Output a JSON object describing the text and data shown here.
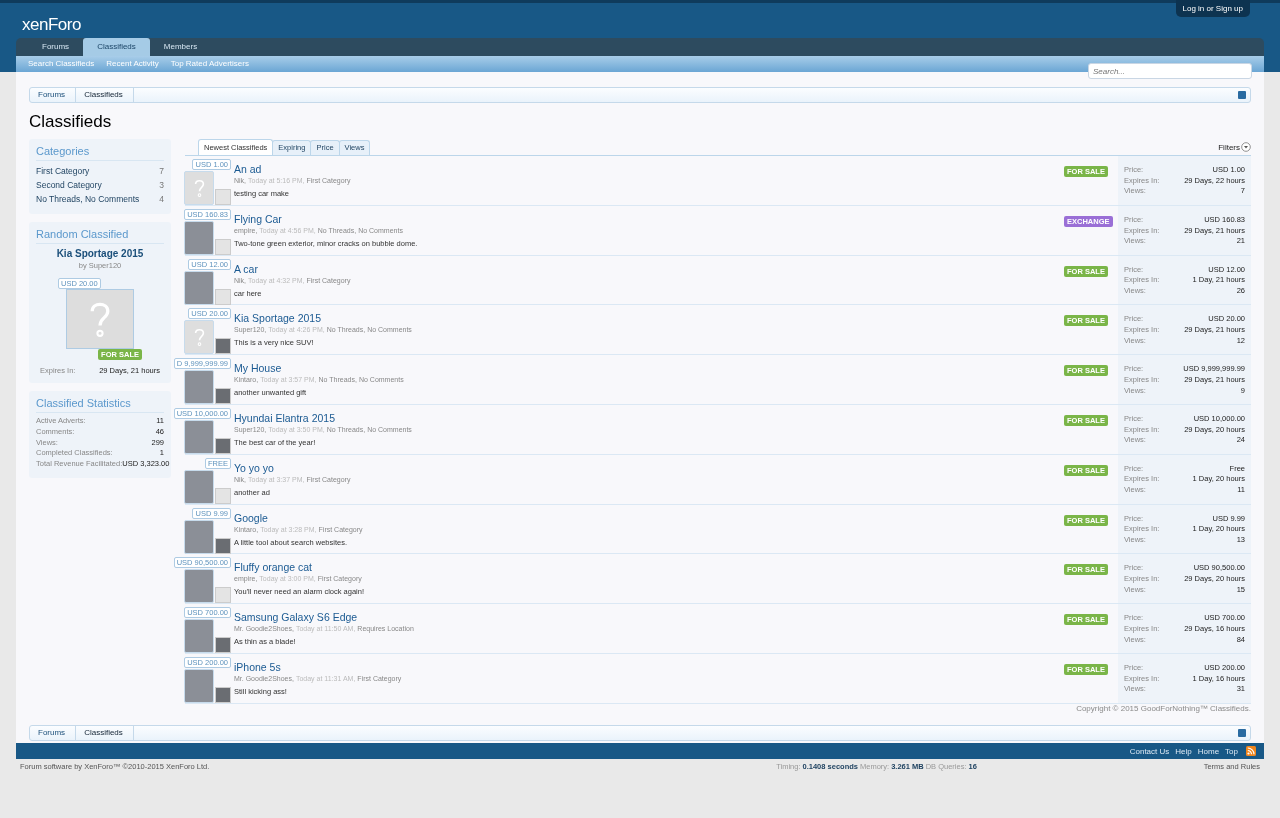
{
  "header": {
    "logo": "xenForo",
    "login": "Log in or Sign up"
  },
  "nav": {
    "tabs": [
      {
        "label": "Forums",
        "selected": false
      },
      {
        "label": "Classifieds",
        "selected": true
      },
      {
        "label": "Members",
        "selected": false
      }
    ],
    "sublinks": [
      "Search Classifieds",
      "Recent Activity",
      "Top Rated Advertisers"
    ],
    "search": {
      "placeholder": "Search..."
    }
  },
  "breadcrumb": [
    "Forums",
    "Classifieds"
  ],
  "title": "Classifieds",
  "sidebar": {
    "categories": {
      "heading": "Categories",
      "items": [
        {
          "label": "First Category",
          "count": "7"
        },
        {
          "label": "Second Category",
          "count": "3"
        },
        {
          "label": "No Threads, No Comments",
          "count": "4"
        }
      ]
    },
    "random": {
      "heading": "Random Classified",
      "title": "Kia Sportage 2015",
      "by": "by Super120",
      "price": "USD 20.00",
      "badge": "FOR SALE",
      "expires_label": "Expires In:",
      "expires": "29 Days, 21 hours"
    },
    "stats": {
      "heading": "Classified Statistics",
      "rows": [
        {
          "label": "Active Adverts:",
          "value": "11"
        },
        {
          "label": "Comments:",
          "value": "46"
        },
        {
          "label": "Views:",
          "value": "299"
        },
        {
          "label": "Completed Classifieds:",
          "value": "1"
        },
        {
          "label": "Total Revenue Facilitated:",
          "value": "USD 3,323.00"
        }
      ]
    }
  },
  "list": {
    "tabs": [
      {
        "label": "Newest Classifieds",
        "selected": true
      },
      {
        "label": "Expiring",
        "selected": false
      },
      {
        "label": "Price",
        "selected": false
      },
      {
        "label": "Views",
        "selected": false
      }
    ],
    "filters": "Filters",
    "rows": [
      {
        "title": "An ad",
        "tag": "USD 1.00",
        "has_photo": false,
        "avatar_photo": false,
        "meta": [
          {
            "kind": "author",
            "text": "Nik,"
          },
          {
            "kind": "date",
            "text": "Today at 5:16 PM,"
          },
          {
            "kind": "link",
            "text": "First Category"
          }
        ],
        "desc": "testing car make",
        "badge": {
          "text": "FOR SALE",
          "color": "#7ab548"
        },
        "price_label": "Price:",
        "price": "USD 1.00",
        "expires_label": "Expires In:",
        "expires": "29 Days, 22 hours",
        "views_label": "Views:",
        "views": "7"
      },
      {
        "title": "Flying Car",
        "tag": "USD 160.83",
        "has_photo": true,
        "avatar_photo": false,
        "meta": [
          {
            "kind": "author",
            "text": "empire,"
          },
          {
            "kind": "date",
            "text": "Today at 4:56 PM,"
          },
          {
            "kind": "link",
            "text": "No Threads,"
          },
          {
            "kind": "link",
            "text": "No Comments"
          }
        ],
        "desc": "Two-tone green exterior, minor cracks on bubble dome.",
        "badge": {
          "text": "EXCHANGE",
          "color": "#9a6fd6"
        },
        "price_label": "Price:",
        "price": "USD 160.83",
        "expires_label": "Expires In:",
        "expires": "29 Days, 21 hours",
        "views_label": "Views:",
        "views": "21"
      },
      {
        "title": "A car",
        "tag": "USD 12.00",
        "has_photo": true,
        "avatar_photo": false,
        "meta": [
          {
            "kind": "author",
            "text": "Nik,"
          },
          {
            "kind": "date",
            "text": "Today at 4:32 PM,"
          },
          {
            "kind": "link",
            "text": "First Category"
          }
        ],
        "desc": "car here",
        "badge": {
          "text": "FOR SALE",
          "color": "#7ab548"
        },
        "price_label": "Price:",
        "price": "USD 12.00",
        "expires_label": "Expires In:",
        "expires": "1 Day, 21 hours",
        "views_label": "Views:",
        "views": "26"
      },
      {
        "title": "Kia Sportage 2015",
        "tag": "USD 20.00",
        "has_photo": false,
        "avatar_photo": true,
        "meta": [
          {
            "kind": "author",
            "text": "Super120,"
          },
          {
            "kind": "date",
            "text": "Today at 4:26 PM,"
          },
          {
            "kind": "link",
            "text": "No Threads,"
          },
          {
            "kind": "link",
            "text": "No Comments"
          }
        ],
        "desc": "This is a very nice SUV!",
        "badge": {
          "text": "FOR SALE",
          "color": "#7ab548"
        },
        "price_label": "Price:",
        "price": "USD 20.00",
        "expires_label": "Expires In:",
        "expires": "29 Days, 21 hours",
        "views_label": "Views:",
        "views": "12"
      },
      {
        "title": "My House",
        "tag": "D 9,999,999.99",
        "has_photo": true,
        "avatar_photo": true,
        "meta": [
          {
            "kind": "author",
            "text": "Kintaro,"
          },
          {
            "kind": "date",
            "text": "Today at 3:57 PM,"
          },
          {
            "kind": "link",
            "text": "No Threads,"
          },
          {
            "kind": "link",
            "text": "No Comments"
          }
        ],
        "desc": "another unwanted gift",
        "badge": {
          "text": "FOR SALE",
          "color": "#7ab548"
        },
        "price_label": "Price:",
        "price": "USD 9,999,999.99",
        "expires_label": "Expires In:",
        "expires": "29 Days, 21 hours",
        "views_label": "Views:",
        "views": "9"
      },
      {
        "title": "Hyundai Elantra 2015",
        "tag": "USD 10,000.00",
        "has_photo": true,
        "avatar_photo": true,
        "meta": [
          {
            "kind": "author",
            "text": "Super120,"
          },
          {
            "kind": "date",
            "text": "Today at 3:50 PM,"
          },
          {
            "kind": "link",
            "text": "No Threads,"
          },
          {
            "kind": "link",
            "text": "No Comments"
          }
        ],
        "desc": "The best car of the year!",
        "badge": {
          "text": "FOR SALE",
          "color": "#7ab548"
        },
        "price_label": "Price:",
        "price": "USD 10,000.00",
        "expires_label": "Expires In:",
        "expires": "29 Days, 20 hours",
        "views_label": "Views:",
        "views": "24"
      },
      {
        "title": "Yo yo yo",
        "tag": "FREE",
        "has_photo": true,
        "avatar_photo": false,
        "meta": [
          {
            "kind": "author",
            "text": "Nik,"
          },
          {
            "kind": "date",
            "text": "Today at 3:37 PM,"
          },
          {
            "kind": "link",
            "text": "First Category"
          }
        ],
        "desc": "another ad",
        "badge": {
          "text": "FOR SALE",
          "color": "#7ab548"
        },
        "price_label": "Price:",
        "price": "Free",
        "expires_label": "Expires In:",
        "expires": "1 Day, 20 hours",
        "views_label": "Views:",
        "views": "11"
      },
      {
        "title": "Google",
        "tag": "USD 9.99",
        "has_photo": true,
        "avatar_photo": true,
        "meta": [
          {
            "kind": "author",
            "text": "Kintaro,"
          },
          {
            "kind": "date",
            "text": "Today at 3:28 PM,"
          },
          {
            "kind": "link",
            "text": "First Category"
          }
        ],
        "desc": "A little tool about search websites.",
        "badge": {
          "text": "FOR SALE",
          "color": "#7ab548"
        },
        "price_label": "Price:",
        "price": "USD 9.99",
        "expires_label": "Expires In:",
        "expires": "1 Day, 20 hours",
        "views_label": "Views:",
        "views": "13"
      },
      {
        "title": "Fluffy orange cat",
        "tag": "USD 90,500.00",
        "has_photo": true,
        "avatar_photo": false,
        "meta": [
          {
            "kind": "author",
            "text": "empire,"
          },
          {
            "kind": "date",
            "text": "Today at 3:00 PM,"
          },
          {
            "kind": "link",
            "text": "First Category"
          }
        ],
        "desc": "You'll never need an alarm clock again!",
        "badge": {
          "text": "FOR SALE",
          "color": "#7ab548"
        },
        "price_label": "Price:",
        "price": "USD 90,500.00",
        "expires_label": "Expires In:",
        "expires": "29 Days, 20 hours",
        "views_label": "Views:",
        "views": "15"
      },
      {
        "title": "Samsung Galaxy S6 Edge",
        "tag": "USD 700.00",
        "has_photo": true,
        "avatar_photo": true,
        "meta": [
          {
            "kind": "author",
            "text": "Mr. Goodie2Shoes,"
          },
          {
            "kind": "date",
            "text": "Today at 11:50 AM,"
          },
          {
            "kind": "link",
            "text": "Requires Location"
          }
        ],
        "desc": "As thin as a blade!",
        "badge": {
          "text": "FOR SALE",
          "color": "#7ab548"
        },
        "price_label": "Price:",
        "price": "USD 700.00",
        "expires_label": "Expires In:",
        "expires": "29 Days, 16 hours",
        "views_label": "Views:",
        "views": "84"
      },
      {
        "title": "iPhone 5s",
        "tag": "USD 200.00",
        "has_photo": true,
        "avatar_photo": true,
        "meta": [
          {
            "kind": "author",
            "text": "Mr. Goodie2Shoes,"
          },
          {
            "kind": "date",
            "text": "Today at 11:31 AM,"
          },
          {
            "kind": "link",
            "text": "First Category"
          }
        ],
        "desc": "Still kicking ass!",
        "badge": {
          "text": "FOR SALE",
          "color": "#7ab548"
        },
        "price_label": "Price:",
        "price": "USD 200.00",
        "expires_label": "Expires In:",
        "expires": "1 Day, 16 hours",
        "views_label": "Views:",
        "views": "31"
      }
    ]
  },
  "copyright": "Copyright © 2015 GoodForNothing™ Classifieds.",
  "breadcrumb_bottom": [
    "Forums",
    "Classifieds"
  ],
  "footer_links": [
    "Contact Us",
    "Help",
    "Home",
    "Top"
  ],
  "footer": {
    "credit": "Forum software by XenForo™ ©2010-2015 XenForo Ltd.",
    "debug": [
      {
        "label": "Timing:",
        "value": "0.1408 seconds"
      },
      {
        "label": "Memory:",
        "value": "3.261 MB"
      },
      {
        "label": "DB Queries:",
        "value": "16"
      }
    ],
    "terms": "Terms and Rules"
  }
}
